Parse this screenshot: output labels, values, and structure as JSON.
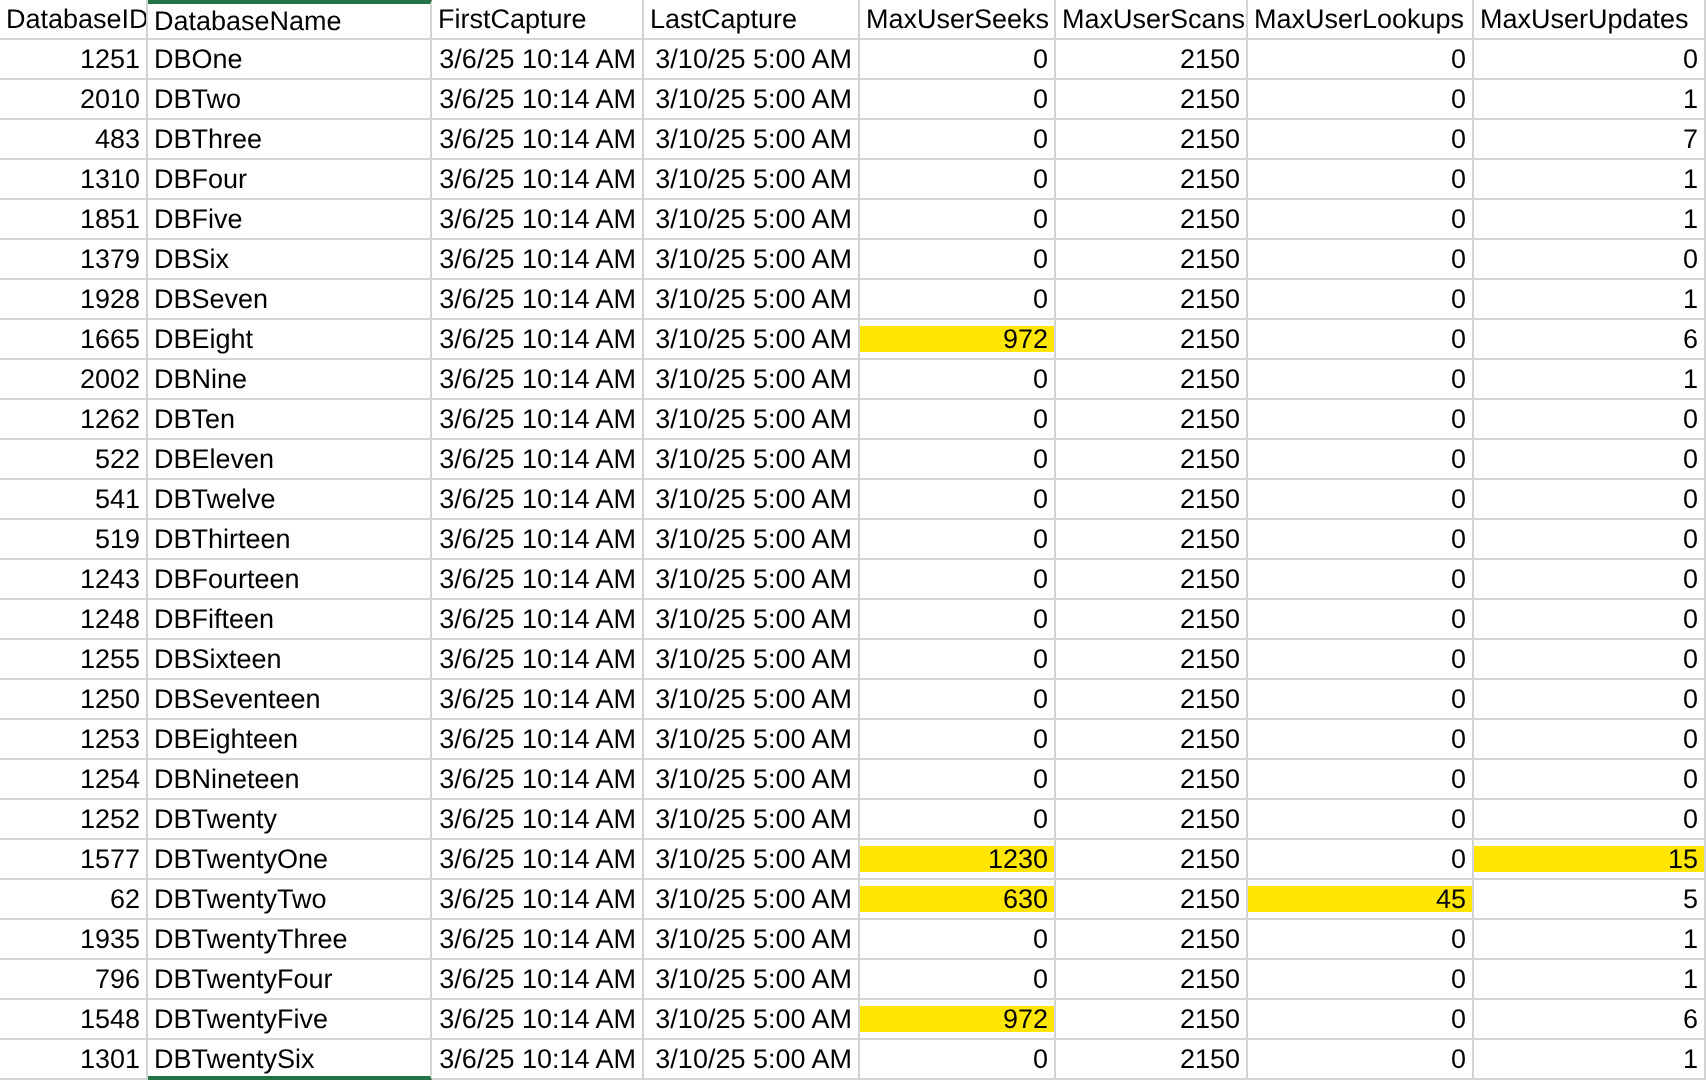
{
  "table": {
    "columns": [
      {
        "label": "DatabaseID",
        "kind": "number",
        "selected": false
      },
      {
        "label": "DatabaseName",
        "kind": "text",
        "selected": true
      },
      {
        "label": "FirstCapture",
        "kind": "number",
        "selected": false
      },
      {
        "label": "LastCapture",
        "kind": "number",
        "selected": false
      },
      {
        "label": "MaxUserSeeks",
        "kind": "number",
        "selected": false
      },
      {
        "label": "MaxUserScans",
        "kind": "number",
        "selected": false
      },
      {
        "label": "MaxUserLookups",
        "kind": "number",
        "selected": false
      },
      {
        "label": "MaxUserUpdates",
        "kind": "number",
        "selected": false
      }
    ],
    "rows": [
      {
        "cells": [
          "1251",
          "DBOne",
          "3/6/25 10:14 AM",
          "3/10/25 5:00 AM",
          "0",
          "2150",
          "0",
          "0"
        ],
        "highlighted": [
          false,
          false,
          false,
          false,
          false,
          false,
          false,
          false
        ]
      },
      {
        "cells": [
          "2010",
          "DBTwo",
          "3/6/25 10:14 AM",
          "3/10/25 5:00 AM",
          "0",
          "2150",
          "0",
          "1"
        ],
        "highlighted": [
          false,
          false,
          false,
          false,
          false,
          false,
          false,
          false
        ]
      },
      {
        "cells": [
          "483",
          "DBThree",
          "3/6/25 10:14 AM",
          "3/10/25 5:00 AM",
          "0",
          "2150",
          "0",
          "7"
        ],
        "highlighted": [
          false,
          false,
          false,
          false,
          false,
          false,
          false,
          false
        ]
      },
      {
        "cells": [
          "1310",
          "DBFour",
          "3/6/25 10:14 AM",
          "3/10/25 5:00 AM",
          "0",
          "2150",
          "0",
          "1"
        ],
        "highlighted": [
          false,
          false,
          false,
          false,
          false,
          false,
          false,
          false
        ]
      },
      {
        "cells": [
          "1851",
          "DBFive",
          "3/6/25 10:14 AM",
          "3/10/25 5:00 AM",
          "0",
          "2150",
          "0",
          "1"
        ],
        "highlighted": [
          false,
          false,
          false,
          false,
          false,
          false,
          false,
          false
        ]
      },
      {
        "cells": [
          "1379",
          "DBSix",
          "3/6/25 10:14 AM",
          "3/10/25 5:00 AM",
          "0",
          "2150",
          "0",
          "0"
        ],
        "highlighted": [
          false,
          false,
          false,
          false,
          false,
          false,
          false,
          false
        ]
      },
      {
        "cells": [
          "1928",
          "DBSeven",
          "3/6/25 10:14 AM",
          "3/10/25 5:00 AM",
          "0",
          "2150",
          "0",
          "1"
        ],
        "highlighted": [
          false,
          false,
          false,
          false,
          false,
          false,
          false,
          false
        ]
      },
      {
        "cells": [
          "1665",
          "DBEight",
          "3/6/25 10:14 AM",
          "3/10/25 5:00 AM",
          "972",
          "2150",
          "0",
          "6"
        ],
        "highlighted": [
          false,
          false,
          false,
          false,
          true,
          false,
          false,
          false
        ]
      },
      {
        "cells": [
          "2002",
          "DBNine",
          "3/6/25 10:14 AM",
          "3/10/25 5:00 AM",
          "0",
          "2150",
          "0",
          "1"
        ],
        "highlighted": [
          false,
          false,
          false,
          false,
          false,
          false,
          false,
          false
        ]
      },
      {
        "cells": [
          "1262",
          "DBTen",
          "3/6/25 10:14 AM",
          "3/10/25 5:00 AM",
          "0",
          "2150",
          "0",
          "0"
        ],
        "highlighted": [
          false,
          false,
          false,
          false,
          false,
          false,
          false,
          false
        ]
      },
      {
        "cells": [
          "522",
          "DBEleven",
          "3/6/25 10:14 AM",
          "3/10/25 5:00 AM",
          "0",
          "2150",
          "0",
          "0"
        ],
        "highlighted": [
          false,
          false,
          false,
          false,
          false,
          false,
          false,
          false
        ]
      },
      {
        "cells": [
          "541",
          "DBTwelve",
          "3/6/25 10:14 AM",
          "3/10/25 5:00 AM",
          "0",
          "2150",
          "0",
          "0"
        ],
        "highlighted": [
          false,
          false,
          false,
          false,
          false,
          false,
          false,
          false
        ]
      },
      {
        "cells": [
          "519",
          "DBThirteen",
          "3/6/25 10:14 AM",
          "3/10/25 5:00 AM",
          "0",
          "2150",
          "0",
          "0"
        ],
        "highlighted": [
          false,
          false,
          false,
          false,
          false,
          false,
          false,
          false
        ]
      },
      {
        "cells": [
          "1243",
          "DBFourteen",
          "3/6/25 10:14 AM",
          "3/10/25 5:00 AM",
          "0",
          "2150",
          "0",
          "0"
        ],
        "highlighted": [
          false,
          false,
          false,
          false,
          false,
          false,
          false,
          false
        ]
      },
      {
        "cells": [
          "1248",
          "DBFifteen",
          "3/6/25 10:14 AM",
          "3/10/25 5:00 AM",
          "0",
          "2150",
          "0",
          "0"
        ],
        "highlighted": [
          false,
          false,
          false,
          false,
          false,
          false,
          false,
          false
        ]
      },
      {
        "cells": [
          "1255",
          "DBSixteen",
          "3/6/25 10:14 AM",
          "3/10/25 5:00 AM",
          "0",
          "2150",
          "0",
          "0"
        ],
        "highlighted": [
          false,
          false,
          false,
          false,
          false,
          false,
          false,
          false
        ]
      },
      {
        "cells": [
          "1250",
          "DBSeventeen",
          "3/6/25 10:14 AM",
          "3/10/25 5:00 AM",
          "0",
          "2150",
          "0",
          "0"
        ],
        "highlighted": [
          false,
          false,
          false,
          false,
          false,
          false,
          false,
          false
        ]
      },
      {
        "cells": [
          "1253",
          "DBEighteen",
          "3/6/25 10:14 AM",
          "3/10/25 5:00 AM",
          "0",
          "2150",
          "0",
          "0"
        ],
        "highlighted": [
          false,
          false,
          false,
          false,
          false,
          false,
          false,
          false
        ]
      },
      {
        "cells": [
          "1254",
          "DBNineteen",
          "3/6/25 10:14 AM",
          "3/10/25 5:00 AM",
          "0",
          "2150",
          "0",
          "0"
        ],
        "highlighted": [
          false,
          false,
          false,
          false,
          false,
          false,
          false,
          false
        ]
      },
      {
        "cells": [
          "1252",
          "DBTwenty",
          "3/6/25 10:14 AM",
          "3/10/25 5:00 AM",
          "0",
          "2150",
          "0",
          "0"
        ],
        "highlighted": [
          false,
          false,
          false,
          false,
          false,
          false,
          false,
          false
        ]
      },
      {
        "cells": [
          "1577",
          "DBTwentyOne",
          "3/6/25 10:14 AM",
          "3/10/25 5:00 AM",
          "1230",
          "2150",
          "0",
          "15"
        ],
        "highlighted": [
          false,
          false,
          false,
          false,
          true,
          false,
          false,
          true
        ]
      },
      {
        "cells": [
          "62",
          "DBTwentyTwo",
          "3/6/25 10:14 AM",
          "3/10/25 5:00 AM",
          "630",
          "2150",
          "45",
          "5"
        ],
        "highlighted": [
          false,
          false,
          false,
          false,
          true,
          false,
          true,
          false
        ]
      },
      {
        "cells": [
          "1935",
          "DBTwentyThree",
          "3/6/25 10:14 AM",
          "3/10/25 5:00 AM",
          "0",
          "2150",
          "0",
          "1"
        ],
        "highlighted": [
          false,
          false,
          false,
          false,
          false,
          false,
          false,
          false
        ]
      },
      {
        "cells": [
          "796",
          "DBTwentyFour",
          "3/6/25 10:14 AM",
          "3/10/25 5:00 AM",
          "0",
          "2150",
          "0",
          "1"
        ],
        "highlighted": [
          false,
          false,
          false,
          false,
          false,
          false,
          false,
          false
        ]
      },
      {
        "cells": [
          "1548",
          "DBTwentyFive",
          "3/6/25 10:14 AM",
          "3/10/25 5:00 AM",
          "972",
          "2150",
          "0",
          "6"
        ],
        "highlighted": [
          false,
          false,
          false,
          false,
          true,
          false,
          false,
          false
        ]
      },
      {
        "cells": [
          "1301",
          "DBTwentySix",
          "3/6/25 10:14 AM",
          "3/10/25 5:00 AM",
          "0",
          "2150",
          "0",
          "1"
        ],
        "highlighted": [
          false,
          false,
          false,
          false,
          false,
          false,
          false,
          false
        ]
      }
    ]
  }
}
